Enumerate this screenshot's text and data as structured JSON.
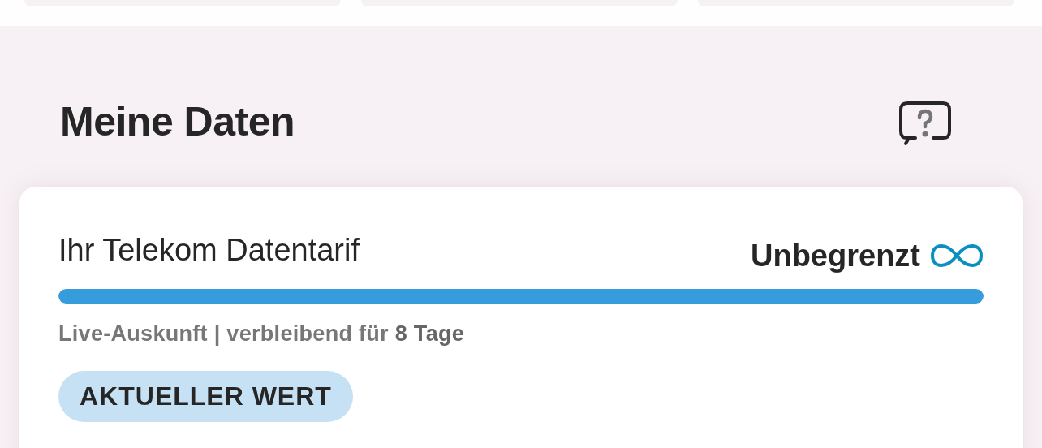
{
  "section": {
    "title": "Meine Daten"
  },
  "plan": {
    "label": "Ihr Telekom Datentarif",
    "value": "Unbegrenzt",
    "level": 1,
    "info": "Live-Auskunft | verbleibend für **8 Tage**",
    "chip": "AKTUELLER WERT"
  }
}
